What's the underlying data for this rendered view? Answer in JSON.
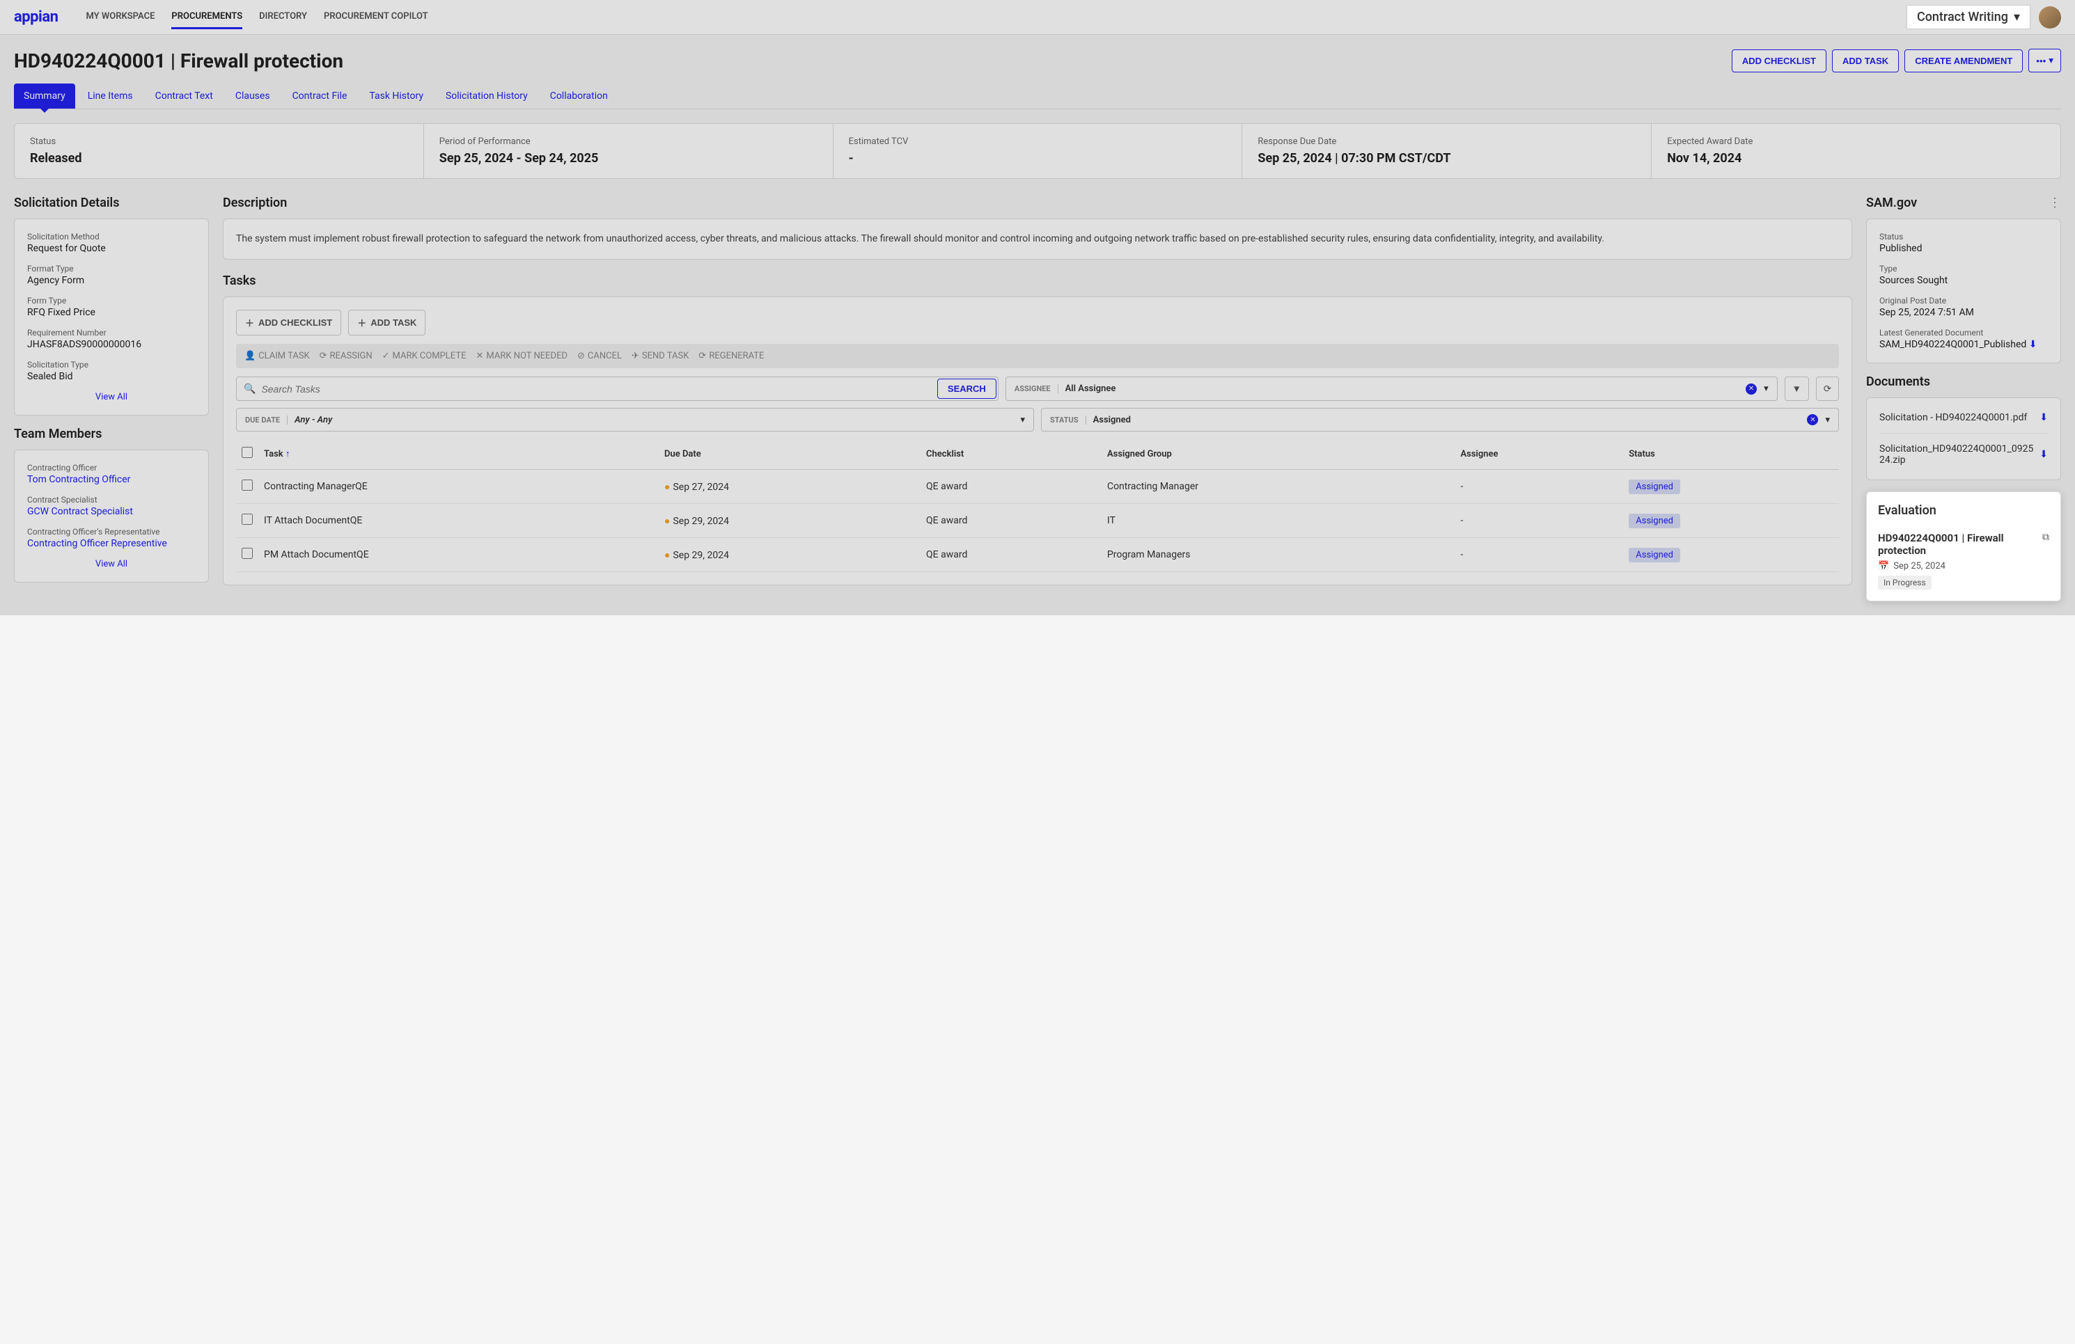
{
  "brand": "appian",
  "nav": {
    "items": [
      "MY WORKSPACE",
      "PROCUREMENTS",
      "DIRECTORY",
      "PROCUREMENT COPILOT"
    ],
    "active": "PROCUREMENTS",
    "contractWriting": "Contract Writing"
  },
  "page": {
    "title": "HD940224Q0001 | Firewall protection",
    "actions": {
      "addChecklist": "ADD CHECKLIST",
      "addTask": "ADD TASK",
      "createAmendment": "CREATE AMENDMENT"
    }
  },
  "tabs": [
    "Summary",
    "Line Items",
    "Contract Text",
    "Clauses",
    "Contract File",
    "Task History",
    "Solicitation History",
    "Collaboration"
  ],
  "activeTab": "Summary",
  "stats": {
    "status": {
      "label": "Status",
      "value": "Released"
    },
    "pop": {
      "label": "Period of Performance",
      "value": "Sep 25, 2024 - Sep 24, 2025"
    },
    "tcv": {
      "label": "Estimated TCV",
      "value": "-"
    },
    "response": {
      "label": "Response Due Date",
      "value": "Sep 25, 2024 | 07:30 PM CST/CDT"
    },
    "award": {
      "label": "Expected Award Date",
      "value": "Nov 14, 2024"
    }
  },
  "solicitation": {
    "title": "Solicitation Details",
    "method": {
      "label": "Solicitation Method",
      "value": "Request for Quote"
    },
    "format": {
      "label": "Format Type",
      "value": "Agency Form"
    },
    "form": {
      "label": "Form Type",
      "value": "RFQ Fixed Price"
    },
    "req": {
      "label": "Requirement Number",
      "value": "JHASF8ADS90000000016"
    },
    "type": {
      "label": "Solicitation Type",
      "value": "Sealed Bid"
    },
    "viewAll": "View All"
  },
  "team": {
    "title": "Team Members",
    "officer": {
      "label": "Contracting Officer",
      "value": "Tom Contracting Officer"
    },
    "specialist": {
      "label": "Contract Specialist",
      "value": "GCW Contract Specialist"
    },
    "rep": {
      "label": "Contracting Officer's Representative",
      "value": "Contracting Officer Representive"
    },
    "viewAll": "View All"
  },
  "description": {
    "title": "Description",
    "text": "The system must implement robust firewall protection to safeguard the network from unauthorized access, cyber threats, and malicious attacks. The firewall should monitor and control incoming and outgoing network traffic based on pre-established security rules, ensuring data confidentiality, integrity, and availability."
  },
  "tasks": {
    "title": "Tasks",
    "addChecklist": "ADD CHECKLIST",
    "addTask": "ADD TASK",
    "bulk": {
      "claim": "CLAIM TASK",
      "reassign": "REASSIGN",
      "complete": "MARK COMPLETE",
      "notNeeded": "MARK NOT NEEDED",
      "cancel": "CANCEL",
      "send": "SEND TASK",
      "regen": "REGENERATE"
    },
    "searchPlaceholder": "Search Tasks",
    "searchBtn": "SEARCH",
    "filters": {
      "assignee": {
        "label": "ASSIGNEE",
        "value": "All Assignee"
      },
      "dueDate": {
        "label": "DUE DATE",
        "value": "Any - Any"
      },
      "status": {
        "label": "STATUS",
        "value": "Assigned"
      }
    },
    "columns": {
      "task": "Task",
      "due": "Due Date",
      "checklist": "Checklist",
      "group": "Assigned Group",
      "assignee": "Assignee",
      "status": "Status"
    },
    "rows": [
      {
        "task": "Contracting ManagerQE",
        "due": "Sep 27, 2024",
        "checklist": "QE award",
        "group": "Contracting Manager",
        "assignee": "-",
        "status": "Assigned"
      },
      {
        "task": "IT   Attach DocumentQE",
        "due": "Sep 29, 2024",
        "checklist": "QE award",
        "group": "IT",
        "assignee": "-",
        "status": "Assigned"
      },
      {
        "task": "PM   Attach DocumentQE",
        "due": "Sep 29, 2024",
        "checklist": "QE award",
        "group": "Program Managers",
        "assignee": "-",
        "status": "Assigned"
      }
    ]
  },
  "sam": {
    "title": "SAM.gov",
    "status": {
      "label": "Status",
      "value": "Published"
    },
    "type": {
      "label": "Type",
      "value": "Sources Sought"
    },
    "postDate": {
      "label": "Original Post Date",
      "value": "Sep 25, 2024 7:51 AM"
    },
    "doc": {
      "label": "Latest Generated Document",
      "value": "SAM_HD940224Q0001_Published"
    }
  },
  "documents": {
    "title": "Documents",
    "items": [
      "Solicitation - HD940224Q0001.pdf",
      "Solicitation_HD940224Q0001_092524.zip"
    ]
  },
  "evaluation": {
    "title": "Evaluation",
    "name": "HD940224Q0001 | Firewall protection",
    "date": "Sep 25, 2024",
    "status": "In Progress"
  }
}
